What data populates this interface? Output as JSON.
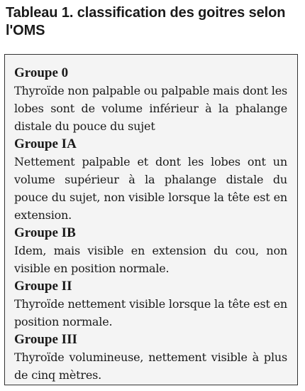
{
  "title": "Tableau 1. classification des goitres selon l'OMS",
  "groups": [
    {
      "title": "Groupe 0",
      "text": "Thyroïde non palpable ou palpable mais dont les lobes sont de volume inférieur à la phalange distale du pouce du sujet"
    },
    {
      "title": "Groupe IA",
      "text": "Nettement palpable et dont les lobes ont un volume supérieur à la phalange distale du pouce du sujet, non visible lorsque la tête est en extension."
    },
    {
      "title": "Groupe IB",
      "text": "Idem, mais visible en extension du cou, non visible en position normale."
    },
    {
      "title": "Groupe II",
      "text": "Thyroïde nettement visible lorsque la tête est en position normale."
    },
    {
      "title": "Groupe III",
      "text": "Thyroïde volumineuse, nettement visible à plus de cinq mètres."
    }
  ]
}
